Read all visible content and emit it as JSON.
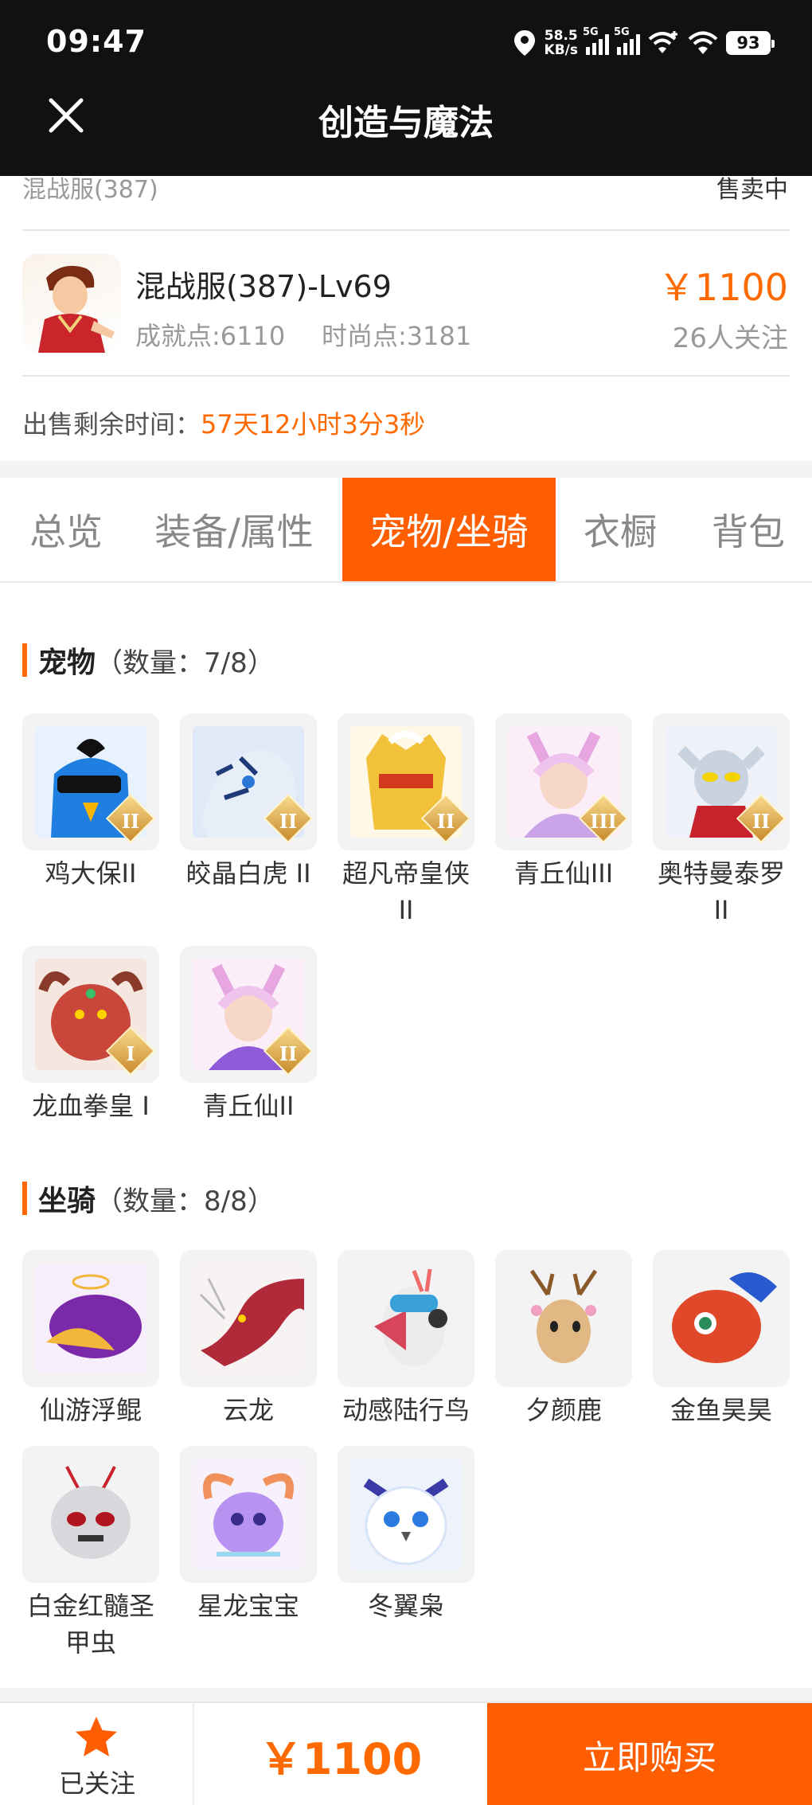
{
  "status_bar": {
    "time": "09:47",
    "net_speed": "58.5",
    "net_unit": "KB/s",
    "sig1_label": "5G",
    "sig2_label": "5G",
    "battery": "93"
  },
  "header": {
    "title": "创造与魔法"
  },
  "summary": {
    "server_peek": "混战服(387)",
    "status_peek": "售卖中",
    "role_name": "混战服(387)-Lv69",
    "achievement": "成就点:6110",
    "fashion": "时尚点:3181",
    "price": "￥1100",
    "followers": "26人关注",
    "remain_label": "出售剩余时间：",
    "remain_value": "57天12小时3分3秒"
  },
  "tabs": [
    "总览",
    "装备/属性",
    "宠物/坐骑",
    "衣橱",
    "背包"
  ],
  "pets": {
    "title": "宠物",
    "count": "（数量：7/8）",
    "items": [
      {
        "name": "鸡大保II",
        "badge": "II"
      },
      {
        "name": "皎晶白虎 II",
        "badge": "II"
      },
      {
        "name": "超凡帝皇侠 II",
        "badge": "II"
      },
      {
        "name": "青丘仙III",
        "badge": "III"
      },
      {
        "name": "奥特曼泰罗 II",
        "badge": "II"
      },
      {
        "name": "龙血拳皇 I",
        "badge": "I"
      },
      {
        "name": "青丘仙II",
        "badge": "II"
      }
    ]
  },
  "mounts": {
    "title": "坐骑",
    "count": "（数量：8/8）",
    "items": [
      {
        "name": "仙游浮鲲"
      },
      {
        "name": "云龙"
      },
      {
        "name": "动感陆行鸟"
      },
      {
        "name": "夕颜鹿"
      },
      {
        "name": "金鱼昊昊"
      },
      {
        "name": "白金红髓圣甲虫"
      },
      {
        "name": "星龙宝宝"
      },
      {
        "name": "冬翼枭"
      }
    ]
  },
  "bottom": {
    "fav_label": "已关注",
    "price": "￥1100",
    "buy_label": "立即购买"
  },
  "colors": {
    "accent": "#ff5e00",
    "price": "#ff6a00",
    "topbar": "#111111"
  }
}
